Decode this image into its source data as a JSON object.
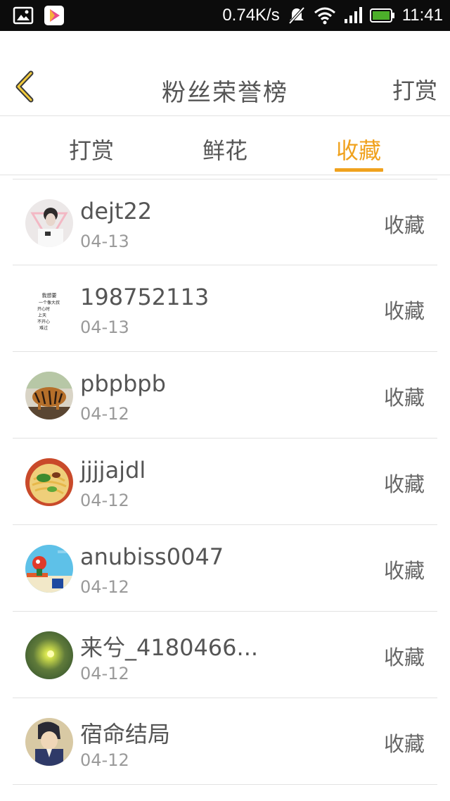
{
  "status_bar": {
    "net_speed": "0.74K/s",
    "time": "11:41",
    "icons": [
      "gallery-icon",
      "play-store-icon",
      "mute-icon",
      "wifi-icon",
      "signal-icon",
      "battery-icon"
    ]
  },
  "header": {
    "title": "粉丝荣誉榜",
    "right_action": "打赏"
  },
  "tabs": [
    {
      "label": "打赏",
      "active": false
    },
    {
      "label": "鲜花",
      "active": false
    },
    {
      "label": "收藏",
      "active": true
    }
  ],
  "colors": {
    "accent": "#f0a21e",
    "text_primary": "#555555",
    "text_secondary": "#9a9a9a",
    "divider": "#e2e2e2"
  },
  "fans": [
    {
      "name": "dejt22",
      "date": "04-13",
      "action": "收藏"
    },
    {
      "name": "198752113",
      "date": "04-13",
      "action": "收藏"
    },
    {
      "name": "pbpbpb",
      "date": "04-12",
      "action": "收藏"
    },
    {
      "name": "jjjjajdl",
      "date": "04-12",
      "action": "收藏"
    },
    {
      "name": "anubiss0047",
      "date": "04-12",
      "action": "收藏"
    },
    {
      "name": "来兮_4180466...",
      "date": "04-12",
      "action": "收藏"
    },
    {
      "name": "宿命结局",
      "date": "04-12",
      "action": "收藏"
    }
  ],
  "avatar_texts": {
    "text_avatar": [
      "我想要",
      "一个像大叔",
      "开心时",
      "上天",
      "不开心",
      "难过"
    ]
  }
}
